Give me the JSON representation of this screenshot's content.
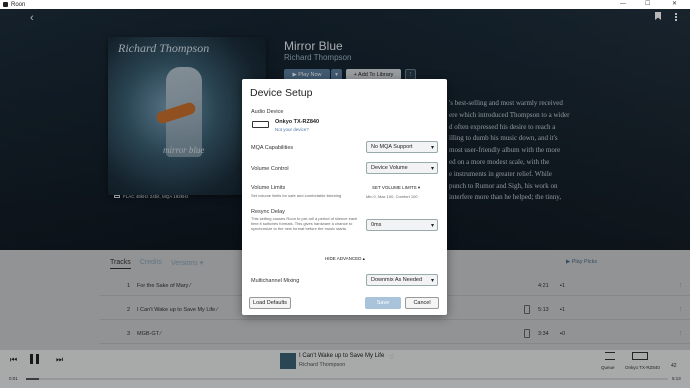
{
  "window": {
    "title": "Roon",
    "minimize": "—",
    "maximize": "☐",
    "close": "✕"
  },
  "nav": {
    "back": "‹"
  },
  "album": {
    "cover_artist": "Richard Thompson",
    "cover_title": "mirror blue",
    "format": "FLAC 48kHz 24bit, MQA 192kHz",
    "title": "Mirror Blue",
    "artist": "Richard Thompson",
    "play_now": "▶ Play Now",
    "play_dd": "▾",
    "add_library": "+ Add To Library",
    "more": "⋮",
    "review_lines": [
      "'s best-selling and most warmly received",
      "ere which introduced Thompson to a wider",
      "d often expressed his desire to reach a",
      "illing to dumb his music down, and it's",
      "most user-friendly album with the more",
      "ed on a more modest scale, with the",
      "e instruments in greater relief. While",
      "punch to Rumor and Sigh, his work on",
      "interfere more than he helped; the tinny,"
    ]
  },
  "tabs": [
    {
      "label": "Tracks",
      "active": true
    },
    {
      "label": "Credits",
      "active": false
    },
    {
      "label": "Versions ▾",
      "active": false
    }
  ],
  "play_picks": "▶ Play Picks",
  "tracks": [
    {
      "num": "1",
      "title": "For the Sake of Mary ⁄",
      "duration": "4:21",
      "plays": "▪1",
      "badge": false
    },
    {
      "num": "2",
      "title": "I Can't Wake up to Save My Life ⁄",
      "duration": "5:13",
      "plays": "▪1",
      "badge": true
    },
    {
      "num": "3",
      "title": "MGB-GT ⁄",
      "duration": "3:34",
      "plays": "▪0",
      "badge": true
    }
  ],
  "track_more": "⋮",
  "now_playing": {
    "title": "I Can't Wake up to Save My Life",
    "artist": "Richard Thompson",
    "heart": "♡",
    "elapsed": "0:01",
    "total": "5:13",
    "progress": 0.02,
    "queue_label": "Queue",
    "zone_label": "Onkyo TX-RZ840",
    "volume": "42"
  },
  "dialog": {
    "title": "Device Setup",
    "audio_device_label": "Audio Device",
    "device_name": "Onkyo TX-RZ840",
    "not_your_device": "Not your device?",
    "mqa_label": "MQA Capabilities",
    "mqa_value": "No MQA Support",
    "volume_control_label": "Volume Control",
    "volume_control_value": "Device Volume",
    "volume_limits_label": "Volume Limits",
    "volume_limits_desc": "Set volume limits for safe and comfortable listening",
    "set_volume_limits": "SET VOLUME LIMITS ▾",
    "volume_limits_values": "Min 0, Max 100, Comfort 100",
    "resync_label": "Resync Delay",
    "resync_desc": "This setting causes Roon to pre-roll a period of silence each time it switches formats. This gives hardware a chance to synchronize to the new format before the music starts.",
    "resync_value": "0ms",
    "hide_advanced": "HIDE ADVANCED ▴",
    "multichannel_label": "Multichannel Mixing",
    "multichannel_value": "Downmix As Needed",
    "load_defaults": "Load Defaults",
    "save": "Save",
    "cancel": "Cancel",
    "caret": "▾"
  },
  "colors": {
    "accent": "#5a7ea0",
    "link": "#4a78a8",
    "save_disabled": "#a9c3db"
  }
}
